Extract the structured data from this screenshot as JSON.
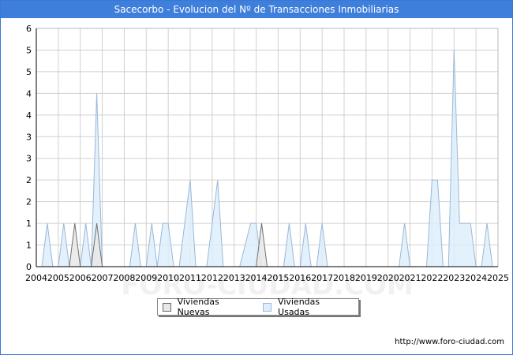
{
  "title": "Sacecorbo - Evolucion del Nº de Transacciones Inmobiliarias",
  "source": "http://www.foro-ciudad.com",
  "colors": {
    "title_bg": "#3f7fdc",
    "nuevas_fill": "#e8e8e8",
    "nuevas_stroke": "#707070",
    "usadas_fill": "#ddeefc",
    "usadas_stroke": "#9ab8d8",
    "grid": "#d0d0d0"
  },
  "chart_data": {
    "type": "area",
    "title": "Sacecorbo - Evolucion del Nº de Transacciones Inmobiliarias",
    "xlabel": "",
    "ylabel": "",
    "x_ticks": [
      "2004",
      "2005",
      "2006",
      "2007",
      "2008",
      "2009",
      "2010",
      "2011",
      "2012",
      "2013",
      "2014",
      "2015",
      "2016",
      "2017",
      "2018",
      "2019",
      "2020",
      "2021",
      "2022",
      "2023",
      "2024",
      "2025"
    ],
    "y_ticks": [
      "0",
      "1",
      "1",
      "2",
      "2",
      "3",
      "3",
      "4",
      "4",
      "5",
      "5",
      "6"
    ],
    "xlim": [
      2004,
      2025
    ],
    "ylim": [
      0,
      5.5
    ],
    "grid": true,
    "legend_position": "bottom",
    "series": [
      {
        "name": "Viviendas Nuevas",
        "points": [
          [
            2005.5,
            0
          ],
          [
            2005.75,
            1
          ],
          [
            2006.0,
            0
          ],
          [
            2006.5,
            0
          ],
          [
            2006.75,
            1
          ],
          [
            2007.0,
            0
          ],
          [
            2014.0,
            0
          ],
          [
            2014.25,
            1
          ],
          [
            2014.5,
            0
          ]
        ]
      },
      {
        "name": "Viviendas Usadas",
        "points": [
          [
            2004.25,
            0
          ],
          [
            2004.5,
            1
          ],
          [
            2004.75,
            0
          ],
          [
            2005.0,
            0
          ],
          [
            2005.25,
            1
          ],
          [
            2005.5,
            0
          ],
          [
            2006.0,
            0
          ],
          [
            2006.25,
            1
          ],
          [
            2006.5,
            0
          ],
          [
            2006.5,
            0
          ],
          [
            2006.75,
            4
          ],
          [
            2007.0,
            0
          ],
          [
            2008.25,
            0
          ],
          [
            2008.5,
            1
          ],
          [
            2008.75,
            0
          ],
          [
            2009.0,
            0
          ],
          [
            2009.25,
            1
          ],
          [
            2009.5,
            0
          ],
          [
            2009.5,
            0
          ],
          [
            2009.75,
            1
          ],
          [
            2010.0,
            1
          ],
          [
            2010.25,
            0
          ],
          [
            2010.5,
            0
          ],
          [
            2011.0,
            2
          ],
          [
            2011.25,
            0
          ],
          [
            2011.75,
            0
          ],
          [
            2012.25,
            2
          ],
          [
            2012.5,
            0
          ],
          [
            2013.25,
            0
          ],
          [
            2013.75,
            1
          ],
          [
            2014.0,
            1
          ],
          [
            2014.25,
            0
          ],
          [
            2015.25,
            0
          ],
          [
            2015.5,
            1
          ],
          [
            2015.75,
            0
          ],
          [
            2016.0,
            0
          ],
          [
            2016.25,
            1
          ],
          [
            2016.5,
            0
          ],
          [
            2016.75,
            0
          ],
          [
            2017.0,
            1
          ],
          [
            2017.25,
            0
          ],
          [
            2020.5,
            0
          ],
          [
            2020.75,
            1
          ],
          [
            2021.0,
            0
          ],
          [
            2021.75,
            0
          ],
          [
            2022.0,
            2
          ],
          [
            2022.25,
            2
          ],
          [
            2022.5,
            0
          ],
          [
            2022.75,
            0
          ],
          [
            2023.0,
            5
          ],
          [
            2023.25,
            1
          ],
          [
            2023.75,
            1
          ],
          [
            2024.0,
            0
          ],
          [
            2024.25,
            0
          ],
          [
            2024.5,
            1
          ],
          [
            2024.75,
            0
          ]
        ]
      }
    ]
  }
}
